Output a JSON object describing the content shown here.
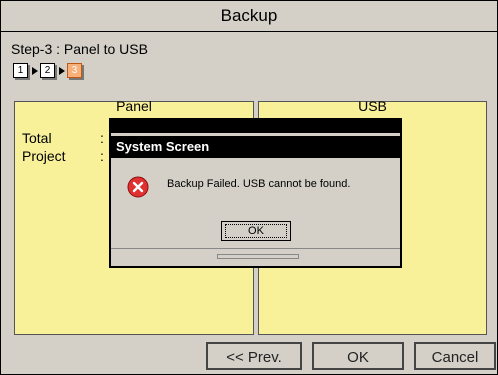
{
  "window": {
    "title": "Backup"
  },
  "step": {
    "text": "Step-3 : Panel to USB"
  },
  "steps": [
    {
      "label": "1"
    },
    {
      "label": "2"
    },
    {
      "label": "3"
    }
  ],
  "panel_left": {
    "title": "Panel",
    "rows": [
      {
        "label": "Total"
      },
      {
        "label": "Project"
      }
    ]
  },
  "panel_right": {
    "title": "USB"
  },
  "buttons": {
    "prev": "<< Prev.",
    "ok": "OK",
    "cancel": "Cancel"
  },
  "dialog": {
    "title": "System Screen",
    "message": "Backup Failed. USB cannot be found.",
    "ok": "OK",
    "icon": "error-icon"
  },
  "colors": {
    "panel_bg": "#f8f19a",
    "active_step": "#f7b07a",
    "dialog_title_bg": "#000000",
    "error_icon": "#e03030"
  }
}
